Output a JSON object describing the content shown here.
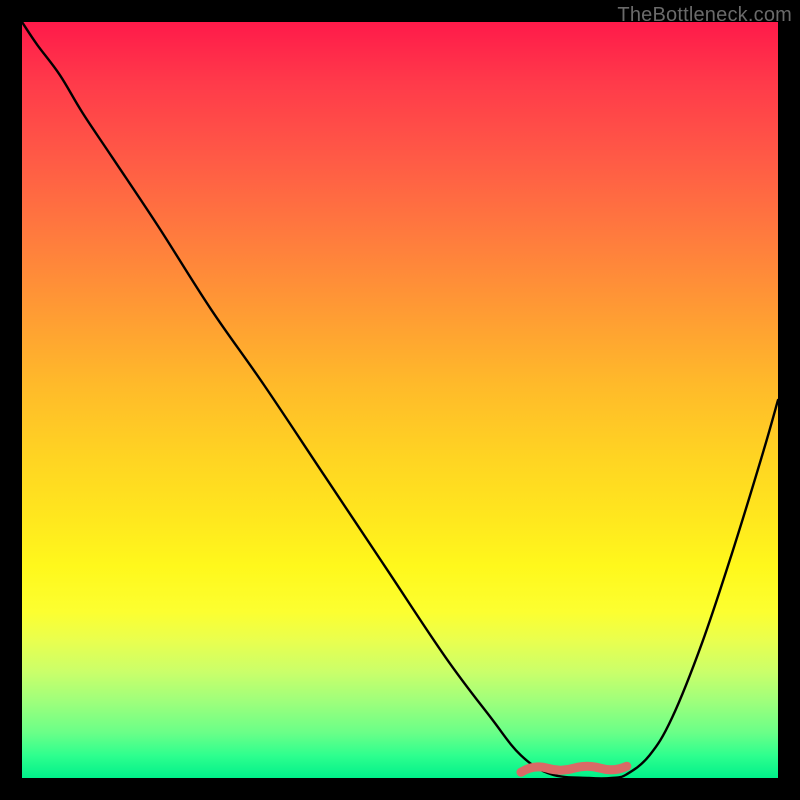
{
  "watermark": "TheBottleneck.com",
  "colors": {
    "curve_stroke": "#000000",
    "marker_stroke": "#d96a66",
    "marker_fill": "none"
  },
  "chart_data": {
    "type": "line",
    "title": "",
    "xlabel": "",
    "ylabel": "",
    "xlim": [
      0,
      100
    ],
    "ylim": [
      0,
      100
    ],
    "grid": false,
    "series": [
      {
        "name": "bottleneck-curve",
        "x": [
          0,
          2,
          5,
          8,
          12,
          18,
          25,
          32,
          40,
          48,
          56,
          62,
          66,
          70,
          75,
          78,
          80,
          83,
          86,
          90,
          94,
          98,
          100
        ],
        "values": [
          100,
          97,
          93,
          88,
          82,
          73,
          62,
          52,
          40,
          28,
          16,
          8,
          3,
          0.5,
          0,
          0,
          0.5,
          3,
          8,
          18,
          30,
          43,
          50
        ]
      }
    ],
    "annotations": [
      {
        "name": "optimal-range-marker",
        "x_start": 66,
        "x_end": 80,
        "y": 0.5
      }
    ]
  }
}
